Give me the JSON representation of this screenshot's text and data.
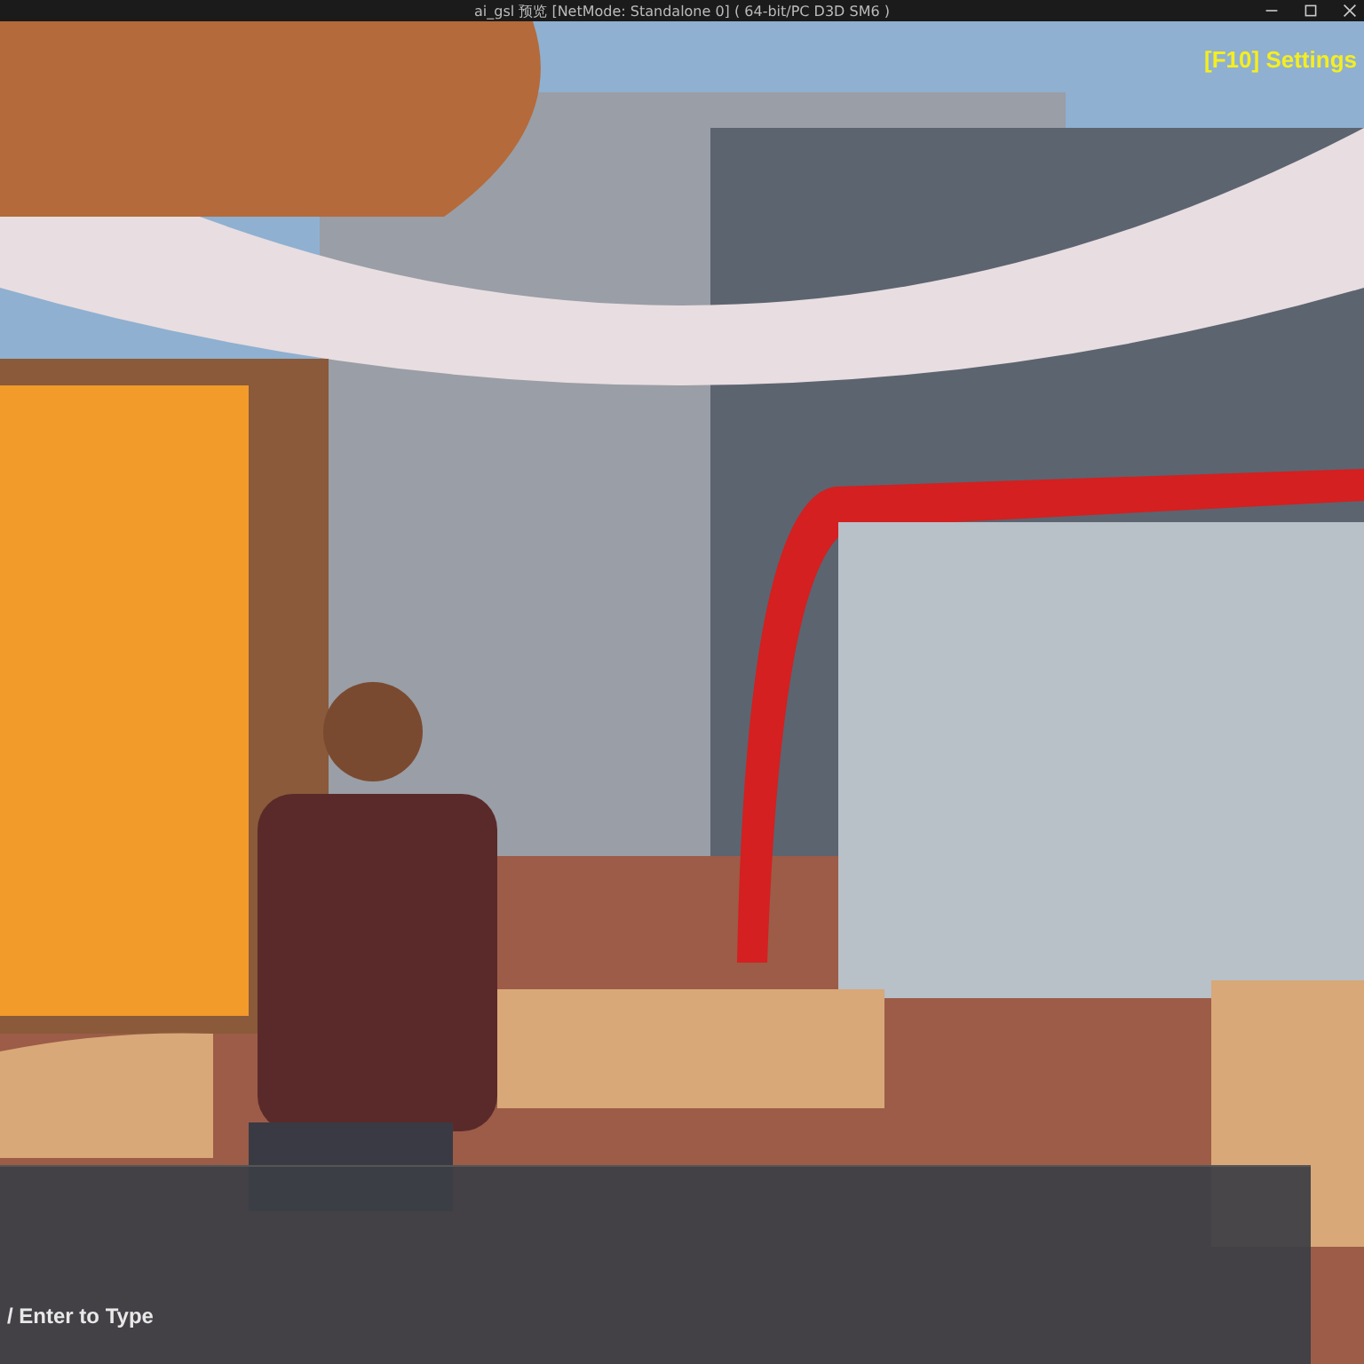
{
  "window": {
    "title": "ai_gsl 预览 [NetMode: Standalone 0]  ( 64-bit/PC D3D SM6 )"
  },
  "hud": {
    "settings_hint": "[F10] Settings"
  },
  "chat": {
    "hint": "/ Enter to Type"
  }
}
